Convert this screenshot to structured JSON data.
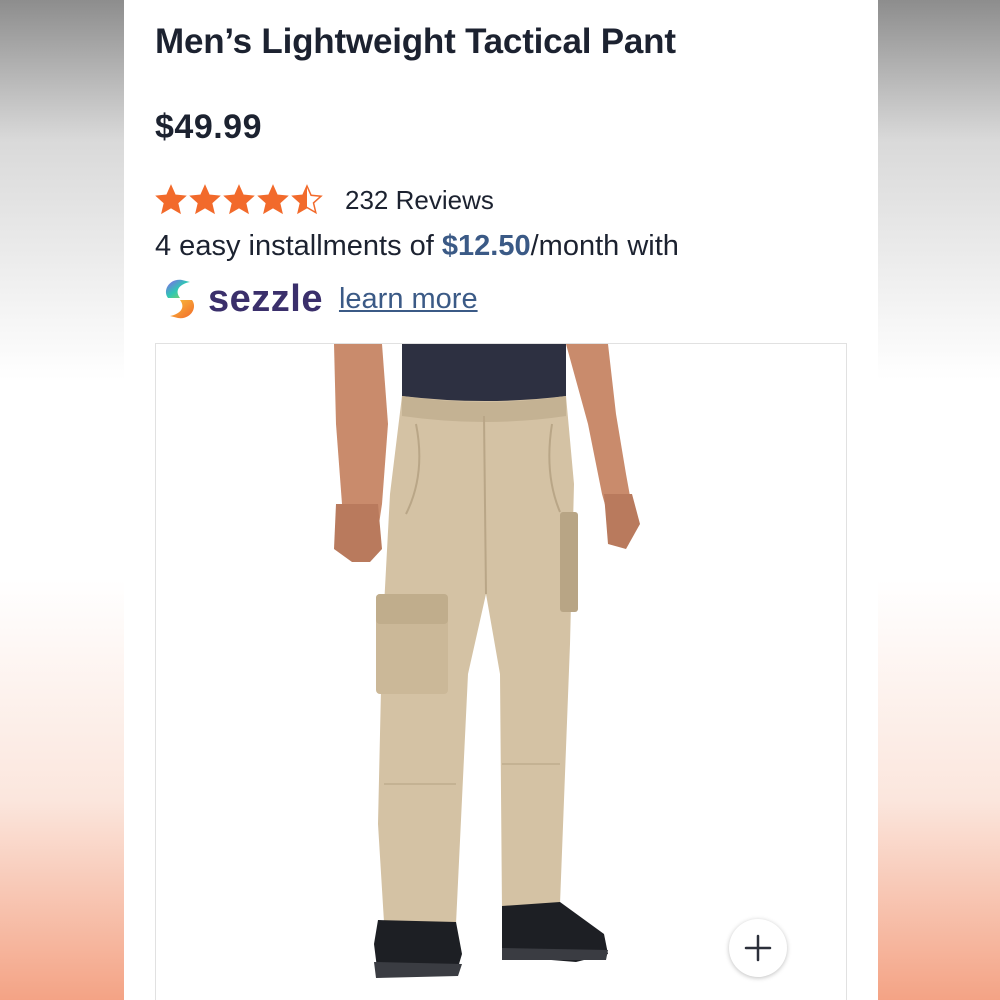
{
  "product": {
    "title": "Men’s Lightweight Tactical Pant",
    "price": "$49.99",
    "rating": 4.5,
    "rating_max": 5,
    "review_count": "232 Reviews"
  },
  "installments": {
    "prefix": "4 easy installments of ",
    "amount": "$12.50",
    "suffix": "/month with"
  },
  "sezzle": {
    "brand": "sezzle",
    "learn_more": "learn more"
  },
  "colors": {
    "star": "#f26a2b",
    "brand_text": "#3a2f6b",
    "link": "#3b5a86"
  },
  "icons": {
    "zoom": "plus-icon",
    "rating": "star-icon"
  }
}
